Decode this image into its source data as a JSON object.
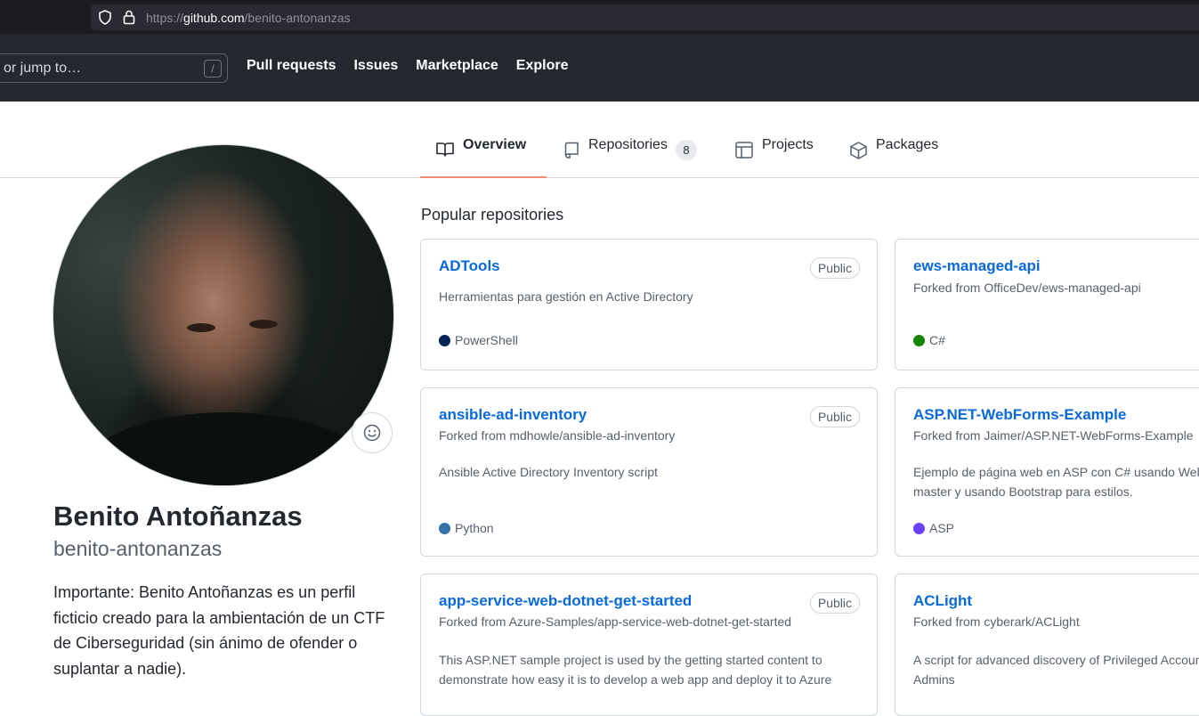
{
  "browser": {
    "url_scheme": "https://",
    "url_host": "github.com",
    "url_path": "/benito-antonanzas"
  },
  "header": {
    "search_placeholder": "or jump to…",
    "slash_hint": "/",
    "nav": [
      "Pull requests",
      "Issues",
      "Marketplace",
      "Explore"
    ]
  },
  "tabs": {
    "overview": "Overview",
    "repositories": "Repositories",
    "repositories_count": "8",
    "projects": "Projects",
    "packages": "Packages"
  },
  "profile": {
    "full_name": "Benito Antoñanzas",
    "username": "benito-antonanzas",
    "bio": "Importante: Benito Antoñanzas es un perfil ficticio creado para la ambientación de un CTF de Ciberseguridad (sin ánimo de ofender o suplantar a nadie)."
  },
  "popular": {
    "title": "Popular repositories",
    "repos": [
      {
        "name": "ADTools",
        "visibility": "Public",
        "description": "Herramientas para gestión en Active Directory",
        "language": "PowerShell",
        "language_color": "#012456"
      },
      {
        "name": "ews-managed-api",
        "forked_from": "Forked from OfficeDev/ews-managed-api",
        "language": "C#",
        "language_color": "#178600"
      },
      {
        "name": "ansible-ad-inventory",
        "visibility": "Public",
        "forked_from": "Forked from mdhowle/ansible-ad-inventory",
        "description": "Ansible Active Directory Inventory script",
        "language": "Python",
        "language_color": "#3572A5"
      },
      {
        "name": "ASP.NET-WebForms-Example",
        "forked_from": "Forked from Jaimer/ASP.NET-WebForms-Example",
        "description_line1": "Ejemplo de página web en ASP con C# usando Web",
        "description_line2": "master y usando Bootstrap para estilos.",
        "language": "ASP",
        "language_color": "#6a40fd"
      },
      {
        "name": "app-service-web-dotnet-get-started",
        "visibility": "Public",
        "forked_from": "Forked from Azure-Samples/app-service-web-dotnet-get-started",
        "description_line1": "This ASP.NET sample project is used by the getting started content to",
        "description_line2": "demonstrate how easy it is to develop a web app and deploy it to Azure"
      },
      {
        "name": "ACLight",
        "forked_from": "Forked from cyberark/ACLight",
        "description_line1": "A script for advanced discovery of Privileged Accounts",
        "description_line2": "Admins"
      }
    ]
  },
  "colors": {
    "accent_link": "#0969da",
    "tab_underline": "#fd8c73",
    "header_bg": "#24292f"
  }
}
